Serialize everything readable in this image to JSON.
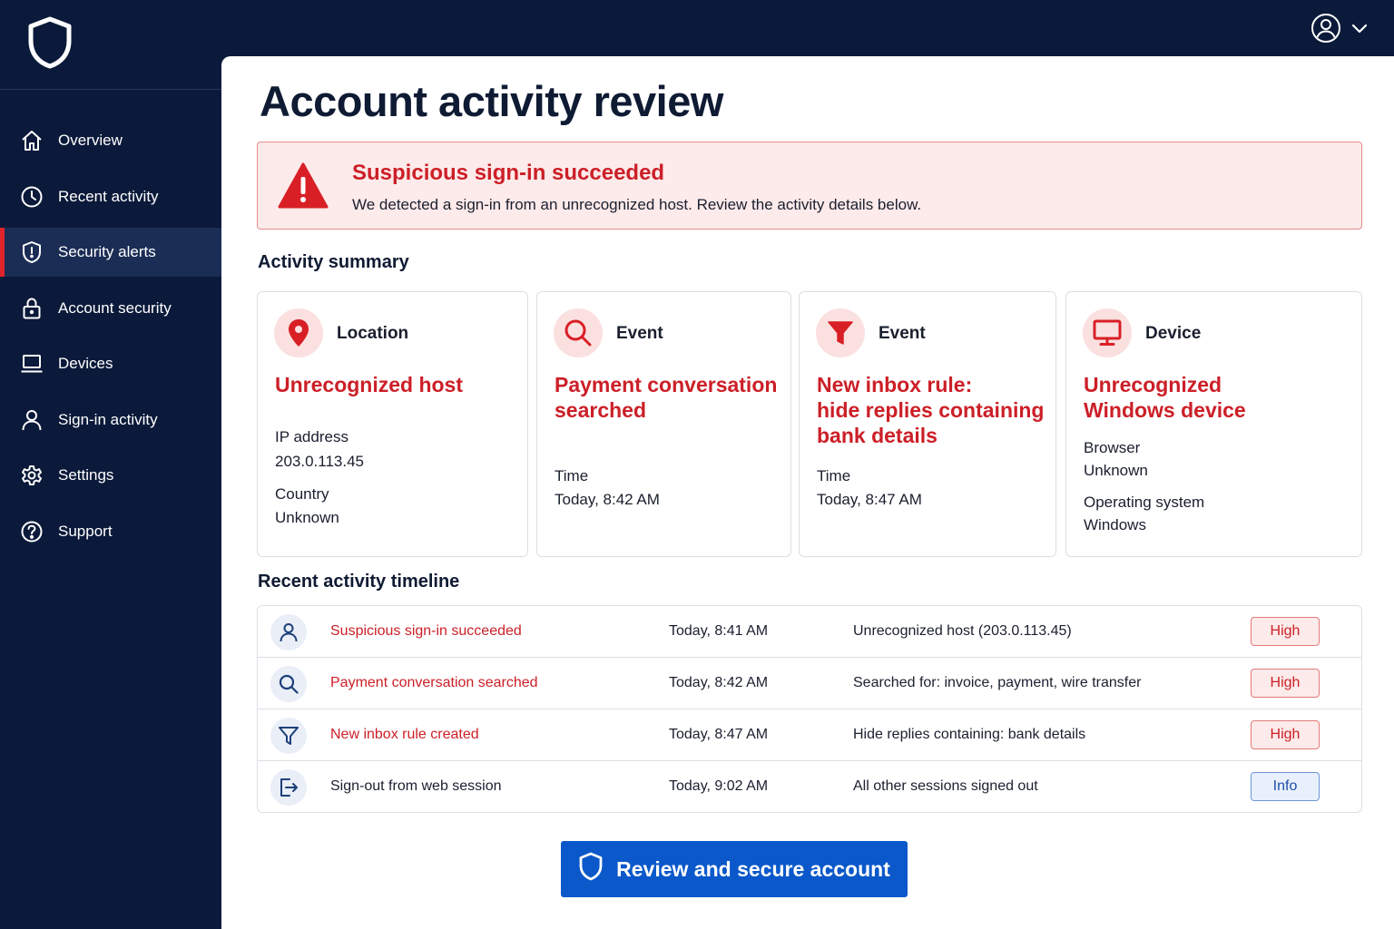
{
  "brand": {
    "logo_icon": "shield-icon"
  },
  "sidebar": {
    "items": [
      {
        "label": "Overview",
        "icon": "home-icon",
        "active": false
      },
      {
        "label": "Recent activity",
        "icon": "clock-icon",
        "active": false
      },
      {
        "label": "Security alerts",
        "icon": "shield-alert-icon",
        "active": true
      },
      {
        "label": "Account security",
        "icon": "lock-icon",
        "active": false
      },
      {
        "label": "Devices",
        "icon": "laptop-icon",
        "active": false
      },
      {
        "label": "Sign-in activity",
        "icon": "person-icon",
        "active": false
      },
      {
        "label": "Settings",
        "icon": "gear-icon",
        "active": false
      },
      {
        "label": "Support",
        "icon": "help-icon",
        "active": false
      }
    ]
  },
  "header": {
    "user_icon": "user-avatar-icon",
    "menu_icon": "chevron-down-icon"
  },
  "page": {
    "title": "Account activity review"
  },
  "alert": {
    "icon": "warning-icon",
    "title": "Suspicious sign-in succeeded",
    "text": "We detected a sign-in from an unrecognized host. Review the activity details below."
  },
  "summary": {
    "title": "Activity summary",
    "cards": [
      {
        "type": "Location",
        "icon": "location-pin-icon",
        "headline": "Unrecognized host",
        "fields": [
          {
            "label": "IP address",
            "value": "203.0.113.45"
          },
          {
            "label": "Country",
            "value": "Unknown"
          }
        ]
      },
      {
        "type": "Event",
        "icon": "search-icon",
        "headline_lines": [
          "Payment conversation",
          "searched"
        ],
        "fields": [
          {
            "label": "Time",
            "value": "Today, 8:42 AM"
          }
        ]
      },
      {
        "type": "Event",
        "icon": "filter-icon",
        "headline_lines": [
          "New inbox rule:",
          "hide replies containing",
          "bank details"
        ],
        "fields": [
          {
            "label": "Time",
            "value": "Today, 8:47 AM"
          }
        ]
      },
      {
        "type": "Device",
        "icon": "monitor-icon",
        "headline_lines": [
          "Unrecognized",
          "Windows device"
        ],
        "fields": [
          {
            "label": "Browser",
            "value": "Unknown"
          },
          {
            "label": "Operating system",
            "value": "Windows"
          }
        ]
      }
    ]
  },
  "timeline": {
    "title": "Recent activity timeline",
    "rows": [
      {
        "icon": "user-icon",
        "event": "Suspicious sign-in succeeded",
        "time": "Today, 8:41 AM",
        "detail": "Unrecognized host (203.0.113.45)",
        "severity": "High",
        "severity_color": "#cc1f27"
      },
      {
        "icon": "search-icon",
        "event": "Payment conversation searched",
        "time": "Today, 8:42 AM",
        "detail": "Searched for: invoice, payment, wire transfer",
        "severity": "High",
        "severity_color": "#cc1f27"
      },
      {
        "icon": "filter-icon",
        "event": "New inbox rule created",
        "time": "Today, 8:47 AM",
        "detail": "Hide replies containing: bank details",
        "severity": "High",
        "severity_color": "#cc1f27"
      },
      {
        "icon": "sign-out-icon",
        "event": "Sign-out from web session",
        "time": "Today, 9:02 AM",
        "detail": "All other sessions signed out",
        "severity": "Info",
        "severity_color": "#1d4fa8"
      }
    ]
  },
  "cta": {
    "label": "Review and secure account",
    "icon": "shield-icon"
  },
  "colors": {
    "sidebar_bg": "#0b1a3a",
    "accent_red": "#cc1f27",
    "primary_blue": "#0a58ca",
    "alert_bg": "#fdeaea"
  }
}
